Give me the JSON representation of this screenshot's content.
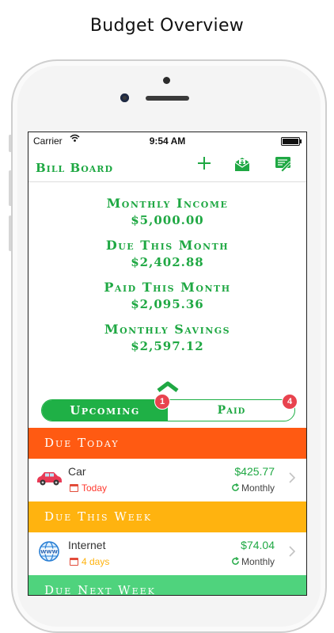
{
  "headline": "Budget Overview",
  "status_bar": {
    "carrier": "Carrier",
    "time": "9:54 AM"
  },
  "navbar": {
    "title": "Bill Board",
    "add_icon": "plus-icon",
    "mail_icon": "envelope-icon",
    "report_icon": "report-icon"
  },
  "summary": [
    {
      "label": "Monthly Income",
      "value": "$5,000.00"
    },
    {
      "label": "Due This Month",
      "value": "$2,402.88"
    },
    {
      "label": "Paid This Month",
      "value": "$2,095.36"
    },
    {
      "label": "Monthly Savings",
      "value": "$2,597.12"
    }
  ],
  "segments": {
    "upcoming": {
      "label": "Upcoming",
      "badge": "1"
    },
    "paid": {
      "label": "Paid",
      "badge": "4"
    }
  },
  "sections": [
    {
      "title": "Due Today",
      "color": "#ff5a12"
    },
    {
      "title": "Due This Week",
      "color": "#ffb30f"
    },
    {
      "title": "Due Next Week",
      "color": "#4fd37d"
    }
  ],
  "bills": [
    {
      "name": "Car",
      "due": "Today",
      "due_color": "#ff3b30",
      "amount": "$425.77",
      "frequency": "Monthly",
      "icon": "car-icon"
    },
    {
      "name": "Internet",
      "due": "4 days",
      "due_color": "#ffb30f",
      "amount": "$74.04",
      "frequency": "Monthly",
      "icon": "globe-www-icon"
    }
  ],
  "colors": {
    "accent": "#1fa843",
    "segment_on": "#1fb046",
    "badge": "#e8434e"
  }
}
